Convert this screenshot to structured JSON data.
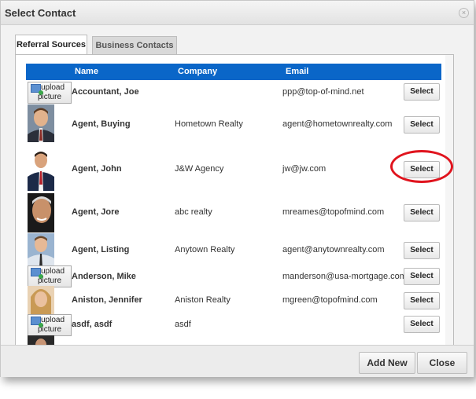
{
  "dialog": {
    "title": "Select Contact",
    "close_glyph": "×"
  },
  "tabs": [
    {
      "label": "Referral Sources",
      "active": true
    },
    {
      "label": "Business Contacts",
      "active": false
    }
  ],
  "table": {
    "headers": {
      "name": "Name",
      "company": "Company",
      "email": "Email"
    },
    "rows": [
      {
        "name": "Accountant, Joe",
        "company": "",
        "email": "ppp@top-of-mind.net",
        "photo": "upload-picture",
        "select": "Select"
      },
      {
        "name": "Agent, Buying",
        "company": "Hometown Realty",
        "email": "agent@hometownrealty.com",
        "photo": "person-photo",
        "select": "Select"
      },
      {
        "name": "Agent, John",
        "company": "J&W Agency",
        "email": "jw@jw.com",
        "photo": "person-photo",
        "select": "Select"
      },
      {
        "name": "Agent, Jore",
        "company": "abc realty",
        "email": "mreames@topofmind.com",
        "photo": "person-photo",
        "select": "Select"
      },
      {
        "name": "Agent, Listing",
        "company": "Anytown Realty",
        "email": "agent@anytownrealty.com",
        "photo": "person-photo",
        "select": "Select"
      },
      {
        "name": "Anderson, Mike",
        "company": "",
        "email": "manderson@usa-mortgage.com",
        "photo": "upload-picture",
        "select": "Select"
      },
      {
        "name": "Aniston, Jennifer",
        "company": "Aniston Realty",
        "email": "mgreen@topofmind.com",
        "photo": "person-photo",
        "select": "Select"
      },
      {
        "name": "asdf, asdf",
        "company": "asdf",
        "email": "",
        "photo": "upload-picture",
        "select": "Select"
      }
    ],
    "upload_label_line1": "upload",
    "upload_label_line2": "picture"
  },
  "footer": {
    "add_new": "Add New",
    "close": "Close"
  },
  "colors": {
    "header_blue": "#0a66c8",
    "highlight_red": "#e0141e"
  }
}
